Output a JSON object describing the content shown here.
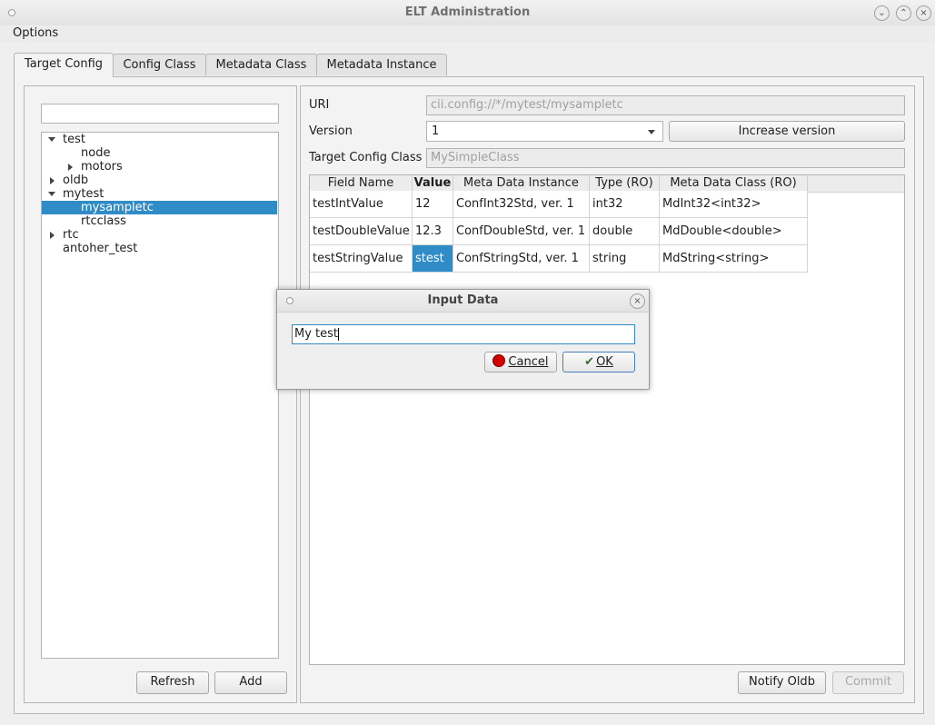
{
  "window": {
    "title": "ELT Administration"
  },
  "menu": {
    "options": "Options"
  },
  "tabs": [
    "Target Config",
    "Config Class",
    "Metadata Class",
    "Metadata Instance"
  ],
  "tree": {
    "search_value": "",
    "items": [
      {
        "label": "test",
        "expanded": true,
        "depth": 0
      },
      {
        "label": "node",
        "depth": 1
      },
      {
        "label": "motors",
        "depth": 1,
        "collapsed": true
      },
      {
        "label": "oldb",
        "depth": 0,
        "collapsed": true
      },
      {
        "label": "mytest",
        "expanded": true,
        "depth": 0
      },
      {
        "label": "mysampletc",
        "depth": 1,
        "selected": true
      },
      {
        "label": "rtcclass",
        "depth": 1
      },
      {
        "label": "rtc",
        "depth": 0,
        "collapsed": true
      },
      {
        "label": "antoher_test",
        "depth": 0
      }
    ],
    "refresh": "Refresh",
    "add": "Add"
  },
  "form": {
    "uri_label": "URI",
    "uri_value": "cii.config://*/mytest/mysampletc",
    "version_label": "Version",
    "version_value": "1",
    "increase_version": "Increase version",
    "class_label": "Target Config Class",
    "class_value": "MySimpleClass"
  },
  "table": {
    "headers": [
      "Field Name",
      "Value",
      "Meta Data Instance",
      "Type (RO)",
      "Meta Data Class (RO)"
    ],
    "rows": [
      [
        "testIntValue",
        "12",
        "ConfInt32Std, ver. 1",
        "int32",
        "MdInt32<int32>"
      ],
      [
        "testDoubleValue",
        "12.3",
        "ConfDoubleStd, ver. 1",
        "double",
        "MdDouble<double>"
      ],
      [
        "testStringValue",
        "stest",
        "ConfStringStd, ver. 1",
        "string",
        "MdString<string>"
      ]
    ]
  },
  "footer": {
    "notify": "Notify Oldb",
    "commit": "Commit"
  },
  "dialog": {
    "title": "Input Data",
    "input_value": "My test",
    "cancel": "Cancel",
    "ok": "OK"
  }
}
